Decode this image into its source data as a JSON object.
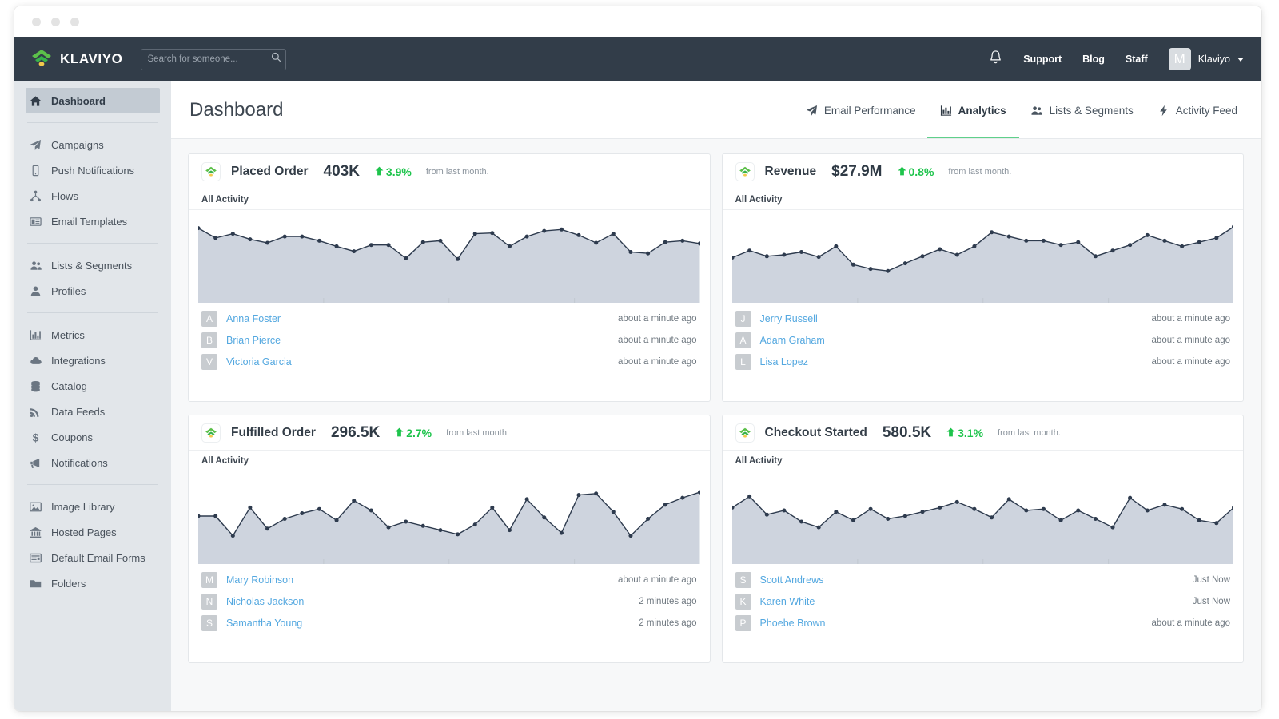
{
  "brand": {
    "name": "KLAVIYO"
  },
  "search": {
    "placeholder": "Search for someone...",
    "value": ""
  },
  "topnav": {
    "support": "Support",
    "blog": "Blog",
    "staff": "Staff",
    "account_initial": "M",
    "account_name": "Klaviyo"
  },
  "sidebar": {
    "groups": [
      [
        {
          "label": "Dashboard",
          "icon": "home-icon",
          "active": true
        }
      ],
      [
        {
          "label": "Campaigns",
          "icon": "paper-plane-icon"
        },
        {
          "label": "Push Notifications",
          "icon": "mobile-icon"
        },
        {
          "label": "Flows",
          "icon": "flow-icon"
        },
        {
          "label": "Email Templates",
          "icon": "template-icon"
        }
      ],
      [
        {
          "label": "Lists & Segments",
          "icon": "users-icon"
        },
        {
          "label": "Profiles",
          "icon": "person-icon"
        }
      ],
      [
        {
          "label": "Metrics",
          "icon": "bar-chart-icon"
        },
        {
          "label": "Integrations",
          "icon": "cloud-icon"
        },
        {
          "label": "Catalog",
          "icon": "database-icon"
        },
        {
          "label": "Data Feeds",
          "icon": "rss-icon"
        },
        {
          "label": "Coupons",
          "icon": "dollar-icon"
        },
        {
          "label": "Notifications",
          "icon": "megaphone-icon"
        }
      ],
      [
        {
          "label": "Image Library",
          "icon": "image-icon"
        },
        {
          "label": "Hosted Pages",
          "icon": "bank-icon"
        },
        {
          "label": "Default Email Forms",
          "icon": "form-icon"
        },
        {
          "label": "Folders",
          "icon": "folder-icon"
        }
      ]
    ]
  },
  "page": {
    "title": "Dashboard",
    "tabs": [
      {
        "label": "Email Performance",
        "icon": "paper-plane-icon",
        "active": false
      },
      {
        "label": "Analytics",
        "icon": "bar-chart-icon",
        "active": true
      },
      {
        "label": "Lists & Segments",
        "icon": "users-icon",
        "active": false
      },
      {
        "label": "Activity Feed",
        "icon": "bolt-icon",
        "active": false
      }
    ]
  },
  "colors": {
    "accent_green": "#5fd08a",
    "delta_green": "#1ec44c",
    "link_blue": "#54a8e0",
    "nav_dark": "#323d49",
    "chart_fill": "#ced4de",
    "chart_line": "#2e3b4e"
  },
  "cards": [
    {
      "metric": "Placed Order",
      "value": "403K",
      "delta": "3.9%",
      "delta_direction": "up",
      "delta_note": "from last month.",
      "section_label": "All Activity",
      "activity": [
        {
          "initial": "A",
          "name": "Anna Foster",
          "time": "about a minute ago"
        },
        {
          "initial": "B",
          "name": "Brian Pierce",
          "time": "about a minute ago"
        },
        {
          "initial": "V",
          "name": "Victoria Garcia",
          "time": "about a minute ago"
        }
      ]
    },
    {
      "metric": "Revenue",
      "value": "$27.9M",
      "delta": "0.8%",
      "delta_direction": "up",
      "delta_note": "from last month.",
      "section_label": "All Activity",
      "activity": [
        {
          "initial": "J",
          "name": "Jerry Russell",
          "time": "about a minute ago"
        },
        {
          "initial": "A",
          "name": "Adam Graham",
          "time": "about a minute ago"
        },
        {
          "initial": "L",
          "name": "Lisa Lopez",
          "time": "about a minute ago"
        }
      ]
    },
    {
      "metric": "Fulfilled Order",
      "value": "296.5K",
      "delta": "2.7%",
      "delta_direction": "up",
      "delta_note": "from last month.",
      "section_label": "All Activity",
      "activity": [
        {
          "initial": "M",
          "name": "Mary Robinson",
          "time": "about a minute ago"
        },
        {
          "initial": "N",
          "name": "Nicholas Jackson",
          "time": "2 minutes ago"
        },
        {
          "initial": "S",
          "name": "Samantha Young",
          "time": "2 minutes ago"
        }
      ]
    },
    {
      "metric": "Checkout Started",
      "value": "580.5K",
      "delta": "3.1%",
      "delta_direction": "up",
      "delta_note": "from last month.",
      "section_label": "All Activity",
      "activity": [
        {
          "initial": "S",
          "name": "Scott Andrews",
          "time": "Just Now"
        },
        {
          "initial": "K",
          "name": "Karen White",
          "time": "Just Now"
        },
        {
          "initial": "P",
          "name": "Phoebe Brown",
          "time": "about a minute ago"
        }
      ]
    }
  ],
  "chart_data": [
    {
      "type": "area",
      "title": "Placed Order",
      "ylim": [
        0,
        100
      ],
      "grid": false,
      "legend": "none",
      "x": [
        1,
        2,
        3,
        4,
        5,
        6,
        7,
        8,
        9,
        10,
        11,
        12,
        13,
        14,
        15,
        16,
        17,
        18,
        19,
        20,
        21,
        22,
        23,
        24,
        25,
        26,
        27,
        28,
        29,
        30
      ],
      "values": [
        88,
        74,
        80,
        72,
        67,
        76,
        76,
        70,
        62,
        55,
        64,
        64,
        45,
        68,
        70,
        44,
        80,
        81,
        62,
        76,
        84,
        86,
        78,
        67,
        80,
        54,
        52,
        68,
        70,
        66
      ]
    },
    {
      "type": "area",
      "title": "Revenue",
      "ylim": [
        0,
        100
      ],
      "grid": false,
      "legend": "none",
      "x": [
        1,
        2,
        3,
        4,
        5,
        6,
        7,
        8,
        9,
        10,
        11,
        12,
        13,
        14,
        15,
        16,
        17,
        18,
        19,
        20,
        21,
        22,
        23,
        24,
        25,
        26,
        27,
        28,
        29,
        30
      ],
      "values": [
        46,
        56,
        48,
        50,
        54,
        47,
        62,
        36,
        30,
        27,
        38,
        48,
        58,
        50,
        62,
        82,
        76,
        70,
        70,
        64,
        68,
        48,
        56,
        64,
        78,
        70,
        62,
        68,
        74,
        90
      ]
    },
    {
      "type": "area",
      "title": "Fulfilled Order",
      "ylim": [
        0,
        100
      ],
      "grid": false,
      "legend": "none",
      "x": [
        1,
        2,
        3,
        4,
        5,
        6,
        7,
        8,
        9,
        10,
        11,
        12,
        13,
        14,
        15,
        16,
        17,
        18,
        19,
        20,
        21,
        22,
        23,
        24,
        25,
        26,
        27,
        28,
        29,
        30
      ],
      "values": [
        50,
        50,
        22,
        62,
        32,
        46,
        54,
        60,
        44,
        72,
        58,
        34,
        42,
        36,
        30,
        24,
        38,
        62,
        30,
        74,
        48,
        26,
        80,
        82,
        56,
        22,
        46,
        66,
        76,
        84
      ]
    },
    {
      "type": "area",
      "title": "Checkout Started",
      "ylim": [
        0,
        100
      ],
      "grid": false,
      "legend": "none",
      "x": [
        1,
        2,
        3,
        4,
        5,
        6,
        7,
        8,
        9,
        10,
        11,
        12,
        13,
        14,
        15,
        16,
        17,
        18,
        19,
        20,
        21,
        22,
        23,
        24,
        25,
        26,
        27,
        28,
        29,
        30
      ],
      "values": [
        62,
        78,
        52,
        58,
        42,
        34,
        56,
        44,
        60,
        46,
        50,
        56,
        62,
        70,
        60,
        48,
        74,
        58,
        60,
        44,
        58,
        46,
        34,
        76,
        58,
        66,
        60,
        44,
        40,
        62
      ]
    }
  ]
}
